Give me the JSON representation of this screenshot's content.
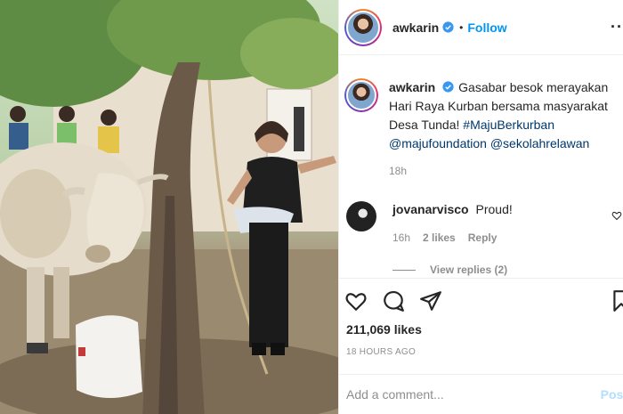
{
  "post": {
    "author": "awkarin",
    "follow_label": "Follow",
    "separator": "•",
    "more_label": "···"
  },
  "caption": {
    "username": "awkarin",
    "text": "Gasabar besok merayakan Hari Raya Kurban bersama masyarakat Desa Tunda! ",
    "hashtag": "#MajuBerkurban",
    "mention1": "@majufoundation",
    "mention2": "@sekolahrelawan",
    "time": "18h"
  },
  "comment": {
    "username": "jovanarvisco",
    "text": "Proud!",
    "time": "16h",
    "likes": "2 likes",
    "reply_label": "Reply"
  },
  "view_replies": "View replies (2)",
  "stats": {
    "likes": "211,069 likes",
    "posted": "18 HOURS AGO"
  },
  "add_comment": {
    "placeholder": "Add a comment...",
    "post_label": "Post"
  },
  "colors": {
    "link": "#0095f6",
    "tag": "#00376b",
    "muted": "#8e8e8e"
  },
  "icons": [
    "verified-badge-icon",
    "more-options-icon",
    "heart-icon",
    "comment-icon",
    "share-icon",
    "save-icon"
  ]
}
